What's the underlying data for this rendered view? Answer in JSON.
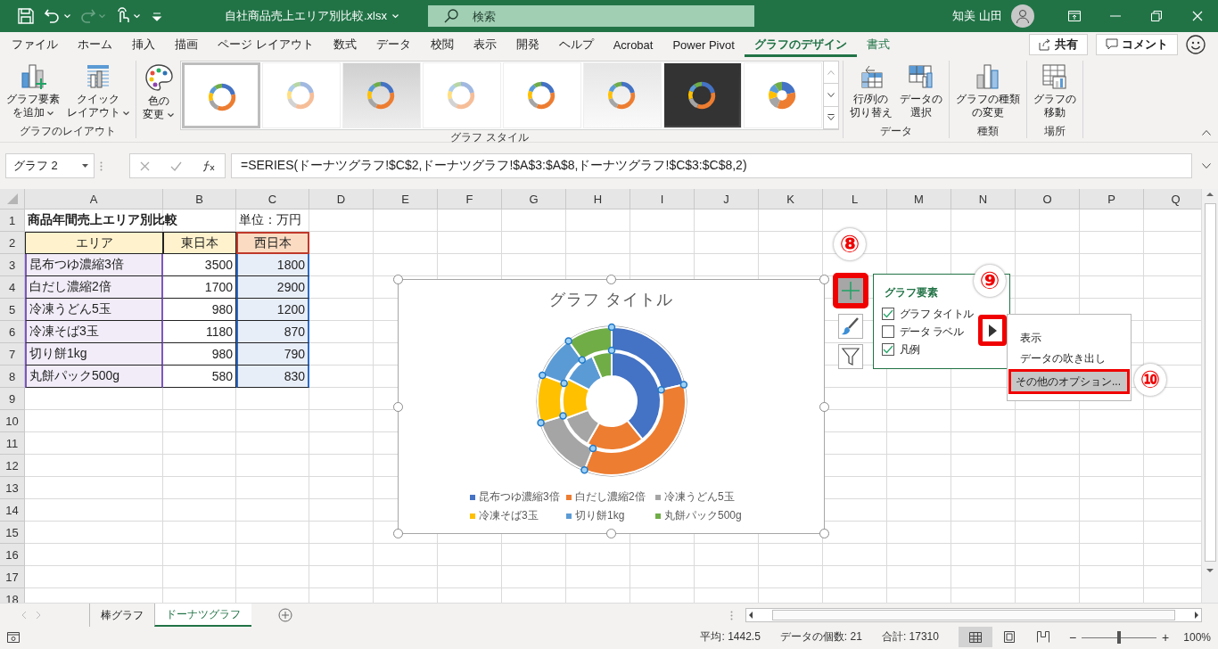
{
  "title_bar": {
    "quick_access": [
      {
        "kind": "save",
        "dropdown": false,
        "disabled": false
      },
      {
        "kind": "undo",
        "dropdown": true,
        "disabled": false
      },
      {
        "kind": "redo",
        "dropdown": true,
        "disabled": true
      },
      {
        "kind": "touch",
        "dropdown": true,
        "disabled": false
      },
      {
        "kind": "customize",
        "dropdown": false,
        "disabled": false
      }
    ],
    "file_name": "自社商品売上エリア別比較.xlsx",
    "search": {
      "placeholder": "検索"
    },
    "user_name": "知美 山田"
  },
  "menu_tabs": [
    {
      "label": "ファイル",
      "selected": false,
      "contextual": false
    },
    {
      "label": "ホーム",
      "selected": false,
      "contextual": false
    },
    {
      "label": "挿入",
      "selected": false,
      "contextual": false
    },
    {
      "label": "描画",
      "selected": false,
      "contextual": false
    },
    {
      "label": "ページ レイアウト",
      "selected": false,
      "contextual": false
    },
    {
      "label": "数式",
      "selected": false,
      "contextual": false
    },
    {
      "label": "データ",
      "selected": false,
      "contextual": false
    },
    {
      "label": "校閲",
      "selected": false,
      "contextual": false
    },
    {
      "label": "表示",
      "selected": false,
      "contextual": false
    },
    {
      "label": "開発",
      "selected": false,
      "contextual": false
    },
    {
      "label": "ヘルプ",
      "selected": false,
      "contextual": false
    },
    {
      "label": "Acrobat",
      "selected": false,
      "contextual": false
    },
    {
      "label": "Power Pivot",
      "selected": false,
      "contextual": false
    },
    {
      "label": "グラフのデザイン",
      "selected": true,
      "contextual": true
    },
    {
      "label": "書式",
      "selected": false,
      "contextual": true
    }
  ],
  "share_button": "共有",
  "comment_button": "コメント",
  "ribbon": {
    "groups": [
      {
        "label": "グラフのレイアウト",
        "buttons": [
          {
            "kind": "add-element",
            "lines": [
              "グラフ要素",
              "を追加"
            ],
            "dropdown": true
          },
          {
            "kind": "quick-layout",
            "lines": [
              "クイック",
              "レイアウト"
            ],
            "dropdown": true
          }
        ]
      },
      {
        "label": "グラフ スタイル",
        "buttons": [
          {
            "kind": "colors",
            "lines": [
              "色の",
              "変更"
            ],
            "dropdown": true
          }
        ],
        "gallery": [
          {
            "kind": "plain",
            "selected": true
          },
          {
            "kind": "hatched-ring",
            "selected": false
          },
          {
            "kind": "gray",
            "selected": false
          },
          {
            "kind": "pale",
            "selected": false
          },
          {
            "kind": "plain",
            "selected": false
          },
          {
            "kind": "striped",
            "selected": false
          },
          {
            "kind": "dark",
            "selected": false
          },
          {
            "kind": "exploded",
            "selected": false
          }
        ]
      },
      {
        "label": "データ",
        "buttons": [
          {
            "kind": "switch",
            "lines": [
              "行/列の",
              "切り替え"
            ],
            "dropdown": false
          },
          {
            "kind": "select-data",
            "lines": [
              "データの",
              "選択"
            ],
            "dropdown": false
          }
        ]
      },
      {
        "label": "種類",
        "buttons": [
          {
            "kind": "chart-type",
            "lines": [
              "グラフの種類",
              "の変更"
            ],
            "dropdown": false
          }
        ]
      },
      {
        "label": "場所",
        "buttons": [
          {
            "kind": "move",
            "lines": [
              "グラフの",
              "移動"
            ],
            "dropdown": false
          }
        ]
      }
    ]
  },
  "formula_bar": {
    "name_box": "グラフ 2",
    "formula": "=SERIES(ドーナツグラフ!$C$2,ドーナツグラフ!$A$3:$A$8,ドーナツグラフ!$C$3:$C$8,2)"
  },
  "sheet": {
    "columns": [
      "A",
      "B",
      "C",
      "D",
      "E",
      "F",
      "G",
      "H",
      "I",
      "J",
      "K",
      "L",
      "M",
      "N",
      "O",
      "P",
      "Q"
    ],
    "rows": [
      {
        "header": "1",
        "cells": [
          {
            "text": "商品年間売上エリア別比較",
            "kind": "title"
          },
          {
            "text": ""
          },
          {
            "text": "単位：万円",
            "kind": "plain"
          }
        ]
      },
      {
        "header": "2",
        "cells": [
          {
            "text": "エリア",
            "kind": "header"
          },
          {
            "text": "東日本",
            "kind": "header"
          },
          {
            "text": "西日本",
            "kind": "series-name"
          }
        ]
      },
      {
        "header": "3",
        "cells": [
          {
            "text": "昆布つゆ濃縮3倍",
            "kind": "category"
          },
          {
            "text": "3500",
            "kind": "value"
          },
          {
            "text": "1800",
            "kind": "series-value"
          }
        ]
      },
      {
        "header": "4",
        "cells": [
          {
            "text": "白だし濃縮2倍",
            "kind": "category"
          },
          {
            "text": "1700",
            "kind": "value"
          },
          {
            "text": "2900",
            "kind": "series-value"
          }
        ]
      },
      {
        "header": "5",
        "cells": [
          {
            "text": "冷凍うどん5玉",
            "kind": "category"
          },
          {
            "text": "980",
            "kind": "value"
          },
          {
            "text": "1200",
            "kind": "series-value"
          }
        ]
      },
      {
        "header": "6",
        "cells": [
          {
            "text": "冷凍そば3玉",
            "kind": "category"
          },
          {
            "text": "1180",
            "kind": "value"
          },
          {
            "text": "870",
            "kind": "series-value"
          }
        ]
      },
      {
        "header": "7",
        "cells": [
          {
            "text": "切り餅1kg",
            "kind": "category"
          },
          {
            "text": "980",
            "kind": "value"
          },
          {
            "text": "790",
            "kind": "series-value"
          }
        ]
      },
      {
        "header": "8",
        "cells": [
          {
            "text": "丸餅パック500g",
            "kind": "category"
          },
          {
            "text": "580",
            "kind": "value"
          },
          {
            "text": "830",
            "kind": "series-value"
          }
        ]
      },
      {
        "header": "9",
        "cells": []
      },
      {
        "header": "10",
        "cells": []
      },
      {
        "header": "11",
        "cells": []
      },
      {
        "header": "12",
        "cells": []
      },
      {
        "header": "13",
        "cells": []
      },
      {
        "header": "14",
        "cells": []
      },
      {
        "header": "15",
        "cells": []
      },
      {
        "header": "16",
        "cells": []
      },
      {
        "header": "17",
        "cells": []
      },
      {
        "header": "18",
        "cells": []
      }
    ]
  },
  "chart": {
    "outer_ring_selected": true,
    "chart_data": {
      "type": "donut",
      "title": "グラフ タイトル",
      "legend": "bottom",
      "categories": [
        "昆布つゆ濃縮3倍",
        "白だし濃縮2倍",
        "冷凍うどん5玉",
        "冷凍そば3玉",
        "切り餅1kg",
        "丸餅パック500g"
      ],
      "series": [
        {
          "values": [
            39.2,
            19.1,
            11.0,
            13.2,
            11.0,
            6.5
          ],
          "colors": [
            "#4472c4",
            "#ed7d31",
            "#a5a5a5",
            "#ffc000",
            "#5b9bd5",
            "#70ad47"
          ]
        },
        {
          "values": [
            21.4,
            34.6,
            14.3,
            10.4,
            9.4,
            9.9
          ],
          "colors": [
            "#4472c4",
            "#ed7d31",
            "#a5a5a5",
            "#ffc000",
            "#5b9bd5",
            "#70ad47"
          ]
        }
      ]
    }
  },
  "chart_tools": [
    {
      "kind": "elements",
      "selected": true,
      "annotated": true
    },
    {
      "kind": "styles",
      "selected": false,
      "annotated": false
    },
    {
      "kind": "filters",
      "selected": false,
      "annotated": false
    }
  ],
  "elements_panel": {
    "title": "グラフ要素",
    "items": [
      {
        "label": "グラフ タイトル",
        "checked": true
      },
      {
        "label": "データ ラベル",
        "checked": false
      },
      {
        "label": "凡例",
        "checked": true
      }
    ],
    "submenu_arrow": {
      "annotated": true
    },
    "submenu": [
      {
        "label": "表示",
        "selected": false,
        "annotated": false
      },
      {
        "label": "データの吹き出し",
        "selected": false,
        "annotated": false
      },
      {
        "label": "その他のオプション...",
        "selected": true,
        "annotated": true
      }
    ]
  },
  "step_markers": [
    {
      "label": "⑧"
    },
    {
      "label": "⑨"
    },
    {
      "label": "⑩"
    }
  ],
  "sheet_tabs": [
    {
      "label": "棒グラフ",
      "selected": false
    },
    {
      "label": "ドーナツグラフ",
      "selected": true
    }
  ],
  "status_bar": {
    "average": "平均: 1442.5",
    "count": "データの個数: 21",
    "sum": "合計: 17310",
    "views": [
      {
        "kind": "normal",
        "selected": true
      },
      {
        "kind": "page-layout",
        "selected": false
      },
      {
        "kind": "page-break",
        "selected": false
      }
    ],
    "zoom": {
      "minus": "−",
      "plus": "+",
      "level": 0.5,
      "value": "100%"
    }
  }
}
